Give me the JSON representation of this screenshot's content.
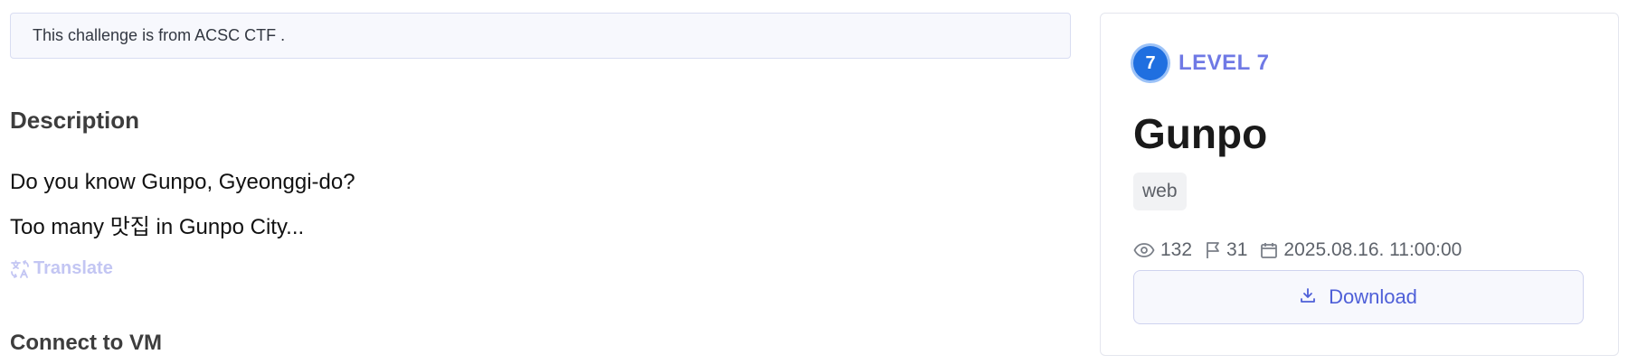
{
  "notice": {
    "text": "This challenge is from ACSC CTF ."
  },
  "description": {
    "title": "Description",
    "lines": [
      "Do you know Gunpo, Gyeonggi-do?",
      "Too many 맛집 in Gunpo City..."
    ],
    "translate_label": "Translate"
  },
  "connect": {
    "title": "Connect to VM"
  },
  "card": {
    "level_number": "7",
    "level_label": "LEVEL 7",
    "title": "Gunpo",
    "tag": "web",
    "views": "132",
    "solves": "31",
    "date": "2025.08.16. 11:00:00",
    "download_label": "Download"
  },
  "icons": {
    "translate": "translate-icon",
    "views": "eye-icon",
    "solves": "flag-icon",
    "date": "calendar-icon",
    "download": "download-icon"
  },
  "colors": {
    "accent": "#6f79e5",
    "level_badge": "#1f6fe0",
    "download_text": "#4e5fd8",
    "translate_text": "#c3c6f3"
  }
}
